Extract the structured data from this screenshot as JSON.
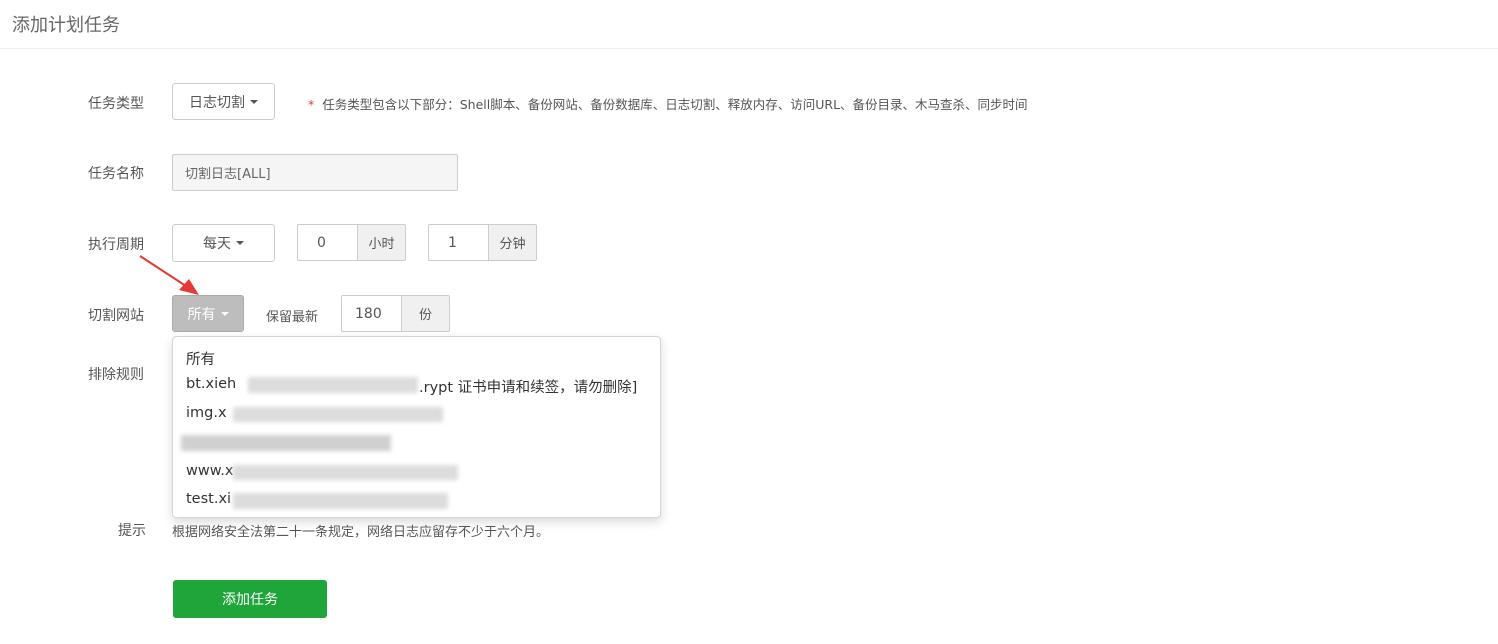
{
  "page": {
    "title": "添加计划任务"
  },
  "form": {
    "task_type": {
      "label": "任务类型",
      "value": "日志切割",
      "note_star": "*",
      "note": "任务类型包含以下部分：Shell脚本、备份网站、备份数据库、日志切割、释放内存、访问URL、备份目录、木马查杀、同步时间"
    },
    "task_name": {
      "label": "任务名称",
      "value": "切割日志[ALL]"
    },
    "period": {
      "label": "执行周期",
      "value": "每天",
      "hour": "0",
      "hour_unit": "小时",
      "minute": "1",
      "minute_unit": "分钟"
    },
    "site": {
      "label": "切割网站",
      "value": "所有",
      "keep_label": "保留最新",
      "keep_value": "180",
      "keep_unit": "份"
    },
    "exclude": {
      "label": "排除规则"
    },
    "tip": {
      "label": "提示",
      "text": "根据网络安全法第二十一条规定，网络日志应留存不少于六个月。"
    },
    "submit_label": "添加任务"
  },
  "site_dropdown": {
    "items": [
      "所有",
      "bt.xieh",
      ".rypt 证书申请和续签，请勿删除]",
      "img.x",
      "www.x",
      "test.xi"
    ]
  },
  "colors": {
    "primary": "#20a53a",
    "required": "#e53935",
    "arrow": "#e53935"
  }
}
